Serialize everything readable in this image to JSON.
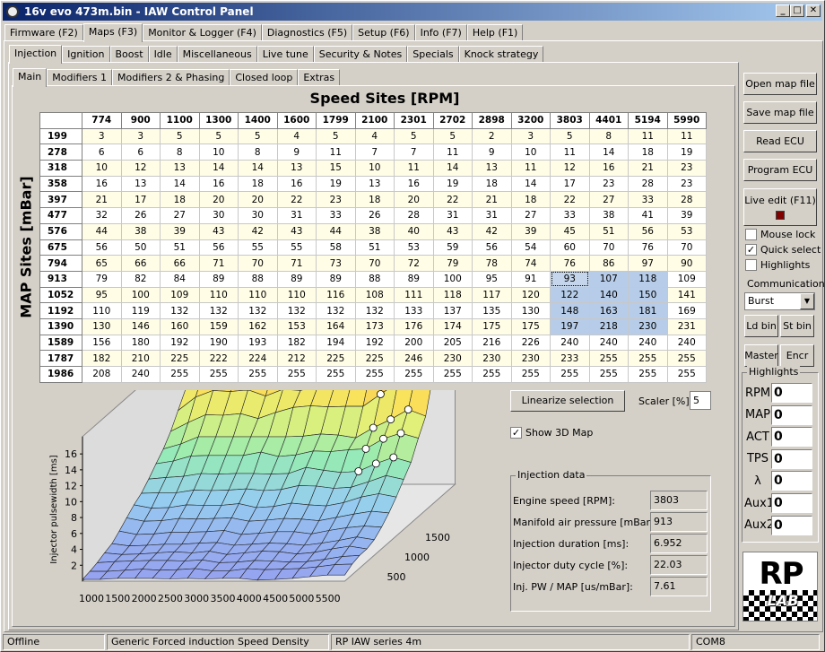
{
  "window": {
    "title": "16v evo 473m.bin - IAW Control Panel",
    "min": "_",
    "max": "□",
    "close": "✕"
  },
  "main_tabs": [
    "Firmware (F2)",
    "Maps (F3)",
    "Monitor & Logger (F4)",
    "Diagnostics (F5)",
    "Setup (F6)",
    "Info (F7)",
    "Help (F1)"
  ],
  "sub_tabs": [
    "Injection",
    "Ignition",
    "Boost",
    "Idle",
    "Miscellaneous",
    "Live tune",
    "Security & Notes",
    "Specials",
    "Knock strategy"
  ],
  "inner_tabs": [
    "Main",
    "Modifiers 1",
    "Modifiers 2 & Phasing",
    "Closed loop",
    "Extras"
  ],
  "table": {
    "x_title": "Speed Sites [RPM]",
    "y_title": "MAP Sites [mBar]",
    "columns": [
      "774",
      "900",
      "1100",
      "1300",
      "1400",
      "1600",
      "1799",
      "2100",
      "2301",
      "2702",
      "2898",
      "3200",
      "3803",
      "4401",
      "5194",
      "5990"
    ],
    "rows": [
      {
        "label": "199",
        "values": [
          "3",
          "3",
          "5",
          "5",
          "5",
          "4",
          "5",
          "4",
          "5",
          "5",
          "2",
          "3",
          "5",
          "8",
          "11",
          "11"
        ]
      },
      {
        "label": "278",
        "values": [
          "6",
          "6",
          "8",
          "10",
          "8",
          "9",
          "11",
          "7",
          "7",
          "11",
          "9",
          "10",
          "11",
          "14",
          "18",
          "19"
        ]
      },
      {
        "label": "318",
        "values": [
          "10",
          "12",
          "13",
          "14",
          "14",
          "13",
          "15",
          "10",
          "11",
          "14",
          "13",
          "11",
          "12",
          "16",
          "21",
          "23"
        ]
      },
      {
        "label": "358",
        "values": [
          "16",
          "13",
          "14",
          "16",
          "18",
          "16",
          "19",
          "13",
          "16",
          "19",
          "18",
          "14",
          "17",
          "23",
          "28",
          "23"
        ]
      },
      {
        "label": "397",
        "values": [
          "21",
          "17",
          "18",
          "20",
          "20",
          "22",
          "23",
          "18",
          "20",
          "22",
          "21",
          "18",
          "22",
          "27",
          "33",
          "28"
        ]
      },
      {
        "label": "477",
        "values": [
          "32",
          "26",
          "27",
          "30",
          "30",
          "31",
          "33",
          "26",
          "28",
          "31",
          "31",
          "27",
          "33",
          "38",
          "41",
          "39"
        ]
      },
      {
        "label": "576",
        "values": [
          "44",
          "38",
          "39",
          "43",
          "42",
          "43",
          "44",
          "38",
          "40",
          "43",
          "42",
          "39",
          "45",
          "51",
          "56",
          "53"
        ]
      },
      {
        "label": "675",
        "values": [
          "56",
          "50",
          "51",
          "56",
          "55",
          "55",
          "58",
          "51",
          "53",
          "59",
          "56",
          "54",
          "60",
          "70",
          "76",
          "70"
        ]
      },
      {
        "label": "794",
        "values": [
          "65",
          "66",
          "66",
          "71",
          "70",
          "71",
          "73",
          "70",
          "72",
          "79",
          "78",
          "74",
          "76",
          "86",
          "97",
          "90"
        ]
      },
      {
        "label": "913",
        "values": [
          "79",
          "82",
          "84",
          "89",
          "88",
          "89",
          "89",
          "88",
          "89",
          "100",
          "95",
          "91",
          "93",
          "107",
          "118",
          "109"
        ]
      },
      {
        "label": "1052",
        "values": [
          "95",
          "100",
          "109",
          "110",
          "110",
          "110",
          "116",
          "108",
          "111",
          "118",
          "117",
          "120",
          "122",
          "140",
          "150",
          "141"
        ]
      },
      {
        "label": "1192",
        "values": [
          "110",
          "119",
          "132",
          "132",
          "132",
          "132",
          "132",
          "132",
          "133",
          "137",
          "135",
          "130",
          "148",
          "163",
          "181",
          "169"
        ]
      },
      {
        "label": "1390",
        "values": [
          "130",
          "146",
          "160",
          "159",
          "162",
          "153",
          "164",
          "173",
          "176",
          "174",
          "175",
          "175",
          "197",
          "218",
          "230",
          "231"
        ]
      },
      {
        "label": "1589",
        "values": [
          "156",
          "180",
          "192",
          "190",
          "193",
          "182",
          "194",
          "192",
          "200",
          "205",
          "216",
          "226",
          "240",
          "240",
          "240",
          "240"
        ]
      },
      {
        "label": "1787",
        "values": [
          "182",
          "210",
          "225",
          "222",
          "224",
          "212",
          "225",
          "225",
          "246",
          "230",
          "230",
          "230",
          "233",
          "255",
          "255",
          "255"
        ]
      },
      {
        "label": "1986",
        "values": [
          "208",
          "240",
          "255",
          "255",
          "255",
          "255",
          "255",
          "255",
          "255",
          "255",
          "255",
          "255",
          "255",
          "255",
          "255",
          "255"
        ]
      }
    ]
  },
  "chart3d": {
    "zlabel": "Injector pulsewidth [ms]",
    "zticks": [
      "2",
      "4",
      "6",
      "8",
      "10",
      "12",
      "14",
      "16"
    ],
    "xticks": [
      "1000",
      "1500",
      "2000",
      "2500",
      "3000",
      "3500",
      "4000",
      "4500",
      "5000",
      "5500"
    ],
    "yticks": [
      "500",
      "1000",
      "1500"
    ]
  },
  "controls": {
    "linearize": "Linearize selection",
    "scaler_label": "Scaler [%]:",
    "scaler_value": "5",
    "show3d": "Show 3D Map",
    "show3d_check": "✓"
  },
  "injection_data": {
    "title": "Injection data",
    "items": [
      {
        "label": "Engine speed [RPM]:",
        "value": "3803"
      },
      {
        "label": "Manifold air pressure [mBar]",
        "value": "913"
      },
      {
        "label": "Injection duration [ms]:",
        "value": "6.952"
      },
      {
        "label": "Injector duty cycle [%]:",
        "value": "22.03"
      },
      {
        "label": "Inj. PW / MAP [us/mBar]:",
        "value": "7.61"
      }
    ]
  },
  "side": {
    "open": "Open map file",
    "save": "Save map file",
    "read": "Read ECU",
    "program": "Program ECU",
    "live": "Live edit (F11)",
    "mouse_lock": "Mouse lock",
    "quick_select": "Quick select",
    "highlights_cb": "Highlights",
    "check": "✓",
    "communication": "Communication",
    "comm_value": "Burst",
    "ldbin": "Ld bin",
    "stbin": "St bin",
    "master": "Master",
    "encr": "Encr",
    "highlights": "Highlights",
    "hl": [
      {
        "label": "RPM",
        "value": "0"
      },
      {
        "label": "MAP",
        "value": "0"
      },
      {
        "label": "ACT",
        "value": "0"
      },
      {
        "label": "TPS",
        "value": "0"
      },
      {
        "label": "λ",
        "value": "0"
      },
      {
        "label": "Aux1",
        "value": "0"
      },
      {
        "label": "Aux2",
        "value": "0"
      }
    ],
    "logo_top": "RP",
    "logo_bottom": "LAB"
  },
  "status": {
    "state": "Offline",
    "strategy": "Generic Forced induction Speed Density",
    "ecu": "RP IAW series 4m",
    "port": "COM8"
  }
}
